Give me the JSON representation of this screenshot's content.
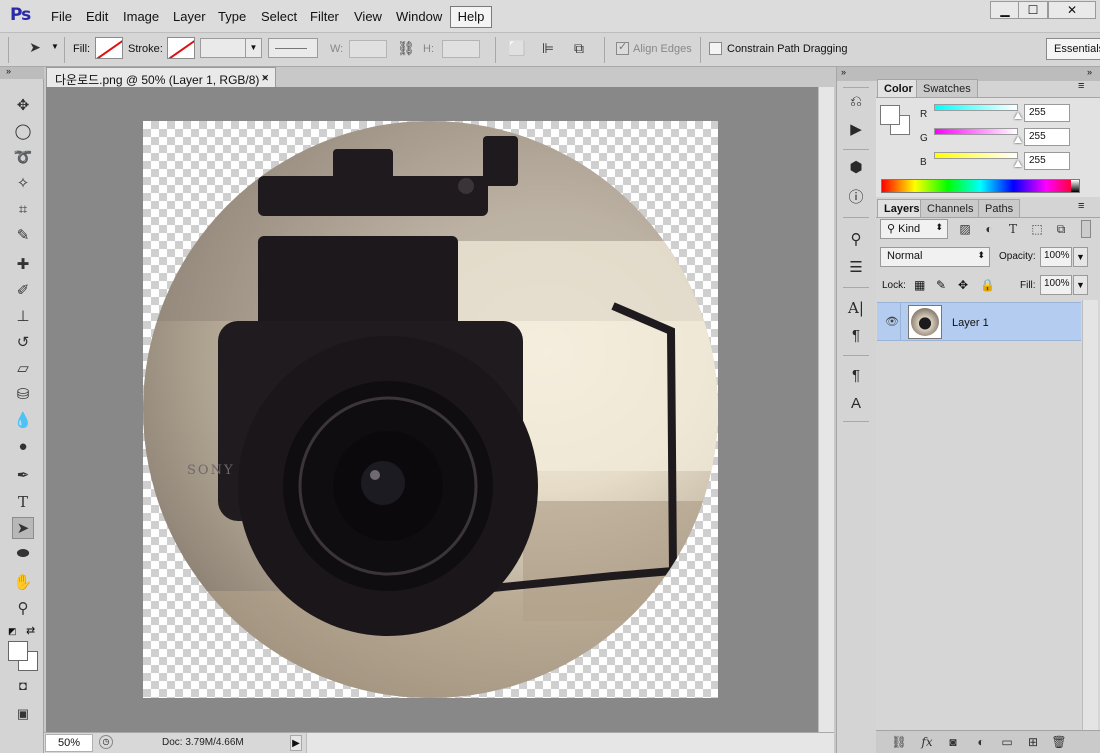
{
  "app": {
    "logo": "Ps"
  },
  "menubar": {
    "items": [
      "File",
      "Edit",
      "Image",
      "Layer",
      "Type",
      "Select",
      "Filter",
      "View",
      "Window"
    ],
    "help": "Help",
    "window_controls": {
      "minimize": "▁",
      "maximize": "☐",
      "close": "✕"
    }
  },
  "options": {
    "fill_label": "Fill:",
    "stroke_label": "Stroke:",
    "w_label": "W:",
    "h_label": "H:",
    "align_edges": "Align Edges",
    "constrain_path": "Constrain Path Dragging",
    "workspace": "Essentials"
  },
  "document": {
    "tab_title": "다운로드.png @ 50% (Layer 1, RGB/8) *",
    "close": "×"
  },
  "status": {
    "zoom": "50%",
    "doc_size": "Doc: 3.79M/4.66M",
    "arrow": "▶"
  },
  "color_panel": {
    "tabs": [
      "Color",
      "Swatches"
    ],
    "channels": [
      {
        "label": "R",
        "value": "255",
        "color": "#00ffff"
      },
      {
        "label": "G",
        "value": "255",
        "color": "#ff00ff"
      },
      {
        "label": "B",
        "value": "255",
        "color": "#ffff00"
      }
    ]
  },
  "layers_panel": {
    "tabs": [
      "Layers",
      "Channels",
      "Paths"
    ],
    "filter_kind": "Kind",
    "blend_mode": "Normal",
    "opacity_label": "Opacity:",
    "opacity_value": "100%",
    "lock_label": "Lock:",
    "fill_label": "Fill:",
    "fill_value": "100%",
    "layers": [
      {
        "name": "Layer 1",
        "visible": true,
        "selected": true
      }
    ]
  },
  "image_text": "SONY",
  "icons": {
    "tools": [
      "move-icon",
      "elliptical-marquee-icon",
      "lasso-icon",
      "magic-wand-icon",
      "crop-icon",
      "eyedropper-icon",
      "healing-brush-icon",
      "brush-icon",
      "clone-stamp-icon",
      "history-brush-icon",
      "eraser-icon",
      "paint-bucket-icon",
      "blur-icon",
      "dodge-icon",
      "pen-icon",
      "type-icon",
      "direct-selection-icon",
      "ellipse-shape-icon",
      "hand-icon",
      "zoom-icon"
    ]
  }
}
